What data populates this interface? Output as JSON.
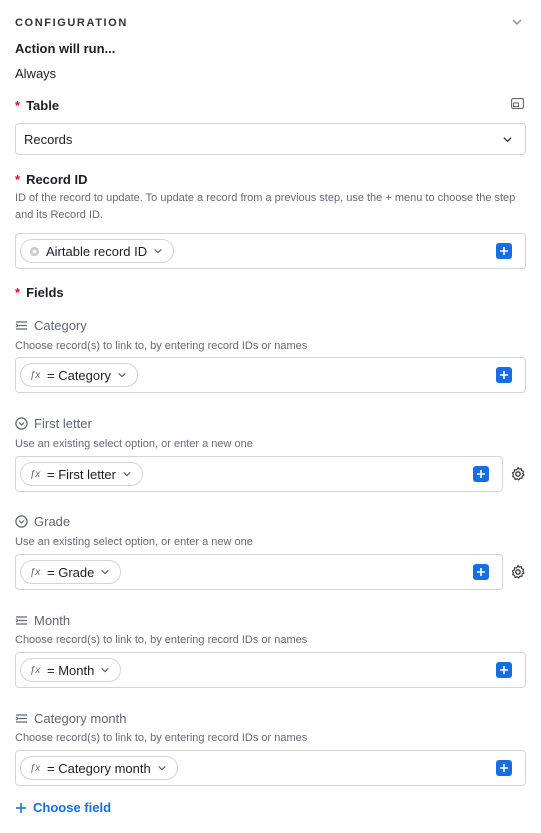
{
  "section": {
    "title": "CONFIGURATION"
  },
  "run": {
    "label": "Action will run...",
    "value": "Always"
  },
  "table": {
    "label": "Table",
    "selected": "Records"
  },
  "record_id": {
    "label": "Record ID",
    "description": "ID of the record to update. To update a record from a previous step, use the + menu to choose the step and its Record ID.",
    "token": "Airtable record ID"
  },
  "fields": {
    "label": "Fields",
    "items": [
      {
        "name": "Category",
        "description": "Choose record(s) to link to, by entering record IDs or names",
        "token": "= Category",
        "icon": "linked-record-icon"
      },
      {
        "name": "First letter",
        "description": "Use an existing select option, or enter a new one",
        "token": "= First letter",
        "icon": "single-select-icon"
      },
      {
        "name": "Grade",
        "description": "Use an existing select option, or enter a new one",
        "token": "= Grade",
        "icon": "single-select-icon"
      },
      {
        "name": "Month",
        "description": "Choose record(s) to link to, by entering record IDs or names",
        "token": "= Month",
        "icon": "linked-record-icon"
      },
      {
        "name": "Category month",
        "description": "Choose record(s) to link to, by entering record IDs or names",
        "token": "= Category month",
        "icon": "linked-record-icon"
      }
    ]
  },
  "choose_field": {
    "label": "Choose field"
  },
  "colors": {
    "accent": "#166ee1",
    "required": "#dc043b",
    "border": "#d3d5d8"
  }
}
